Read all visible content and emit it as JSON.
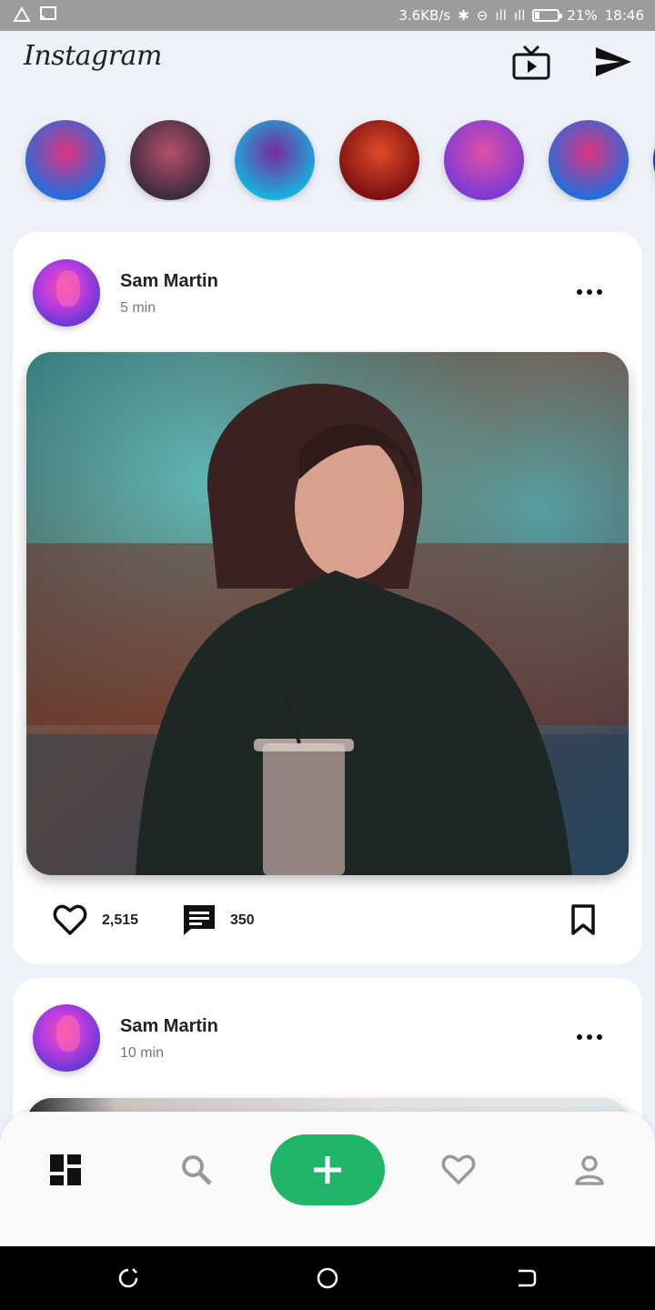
{
  "status_bar": {
    "net_speed": "3.6KB/s",
    "battery_percent": "21%",
    "battery_level": 0.21,
    "time": "18:46"
  },
  "app": {
    "title": "Instagram"
  },
  "header": {
    "icons": [
      "tv-icon",
      "send-icon"
    ]
  },
  "stories": {
    "items": [
      {
        "icon": "story-avatar",
        "colors": [
          "#1e6fe0",
          "#e0337e"
        ]
      },
      {
        "icon": "story-avatar",
        "colors": [
          "#3a2a3e",
          "#b4506a"
        ]
      },
      {
        "icon": "story-avatar",
        "colors": [
          "#14b4e0",
          "#7a2a9a"
        ]
      },
      {
        "icon": "story-avatar",
        "colors": [
          "#7a1010",
          "#e04a2a"
        ]
      },
      {
        "icon": "story-avatar",
        "colors": [
          "#7a3ad6",
          "#e04fa8"
        ]
      },
      {
        "icon": "story-avatar",
        "colors": [
          "#1e6fe0",
          "#e0337e"
        ]
      }
    ]
  },
  "posts": [
    {
      "user": "Sam Martin",
      "time": "5 min",
      "likes": "2,515",
      "comments": "350"
    },
    {
      "user": "Sam Martin",
      "time": "10 min"
    }
  ],
  "bottom_nav": {
    "items": [
      "dashboard-icon",
      "search-icon",
      "add-icon",
      "heart-icon",
      "profile-icon"
    ],
    "active": "dashboard-icon",
    "accent": "#21b56a"
  }
}
